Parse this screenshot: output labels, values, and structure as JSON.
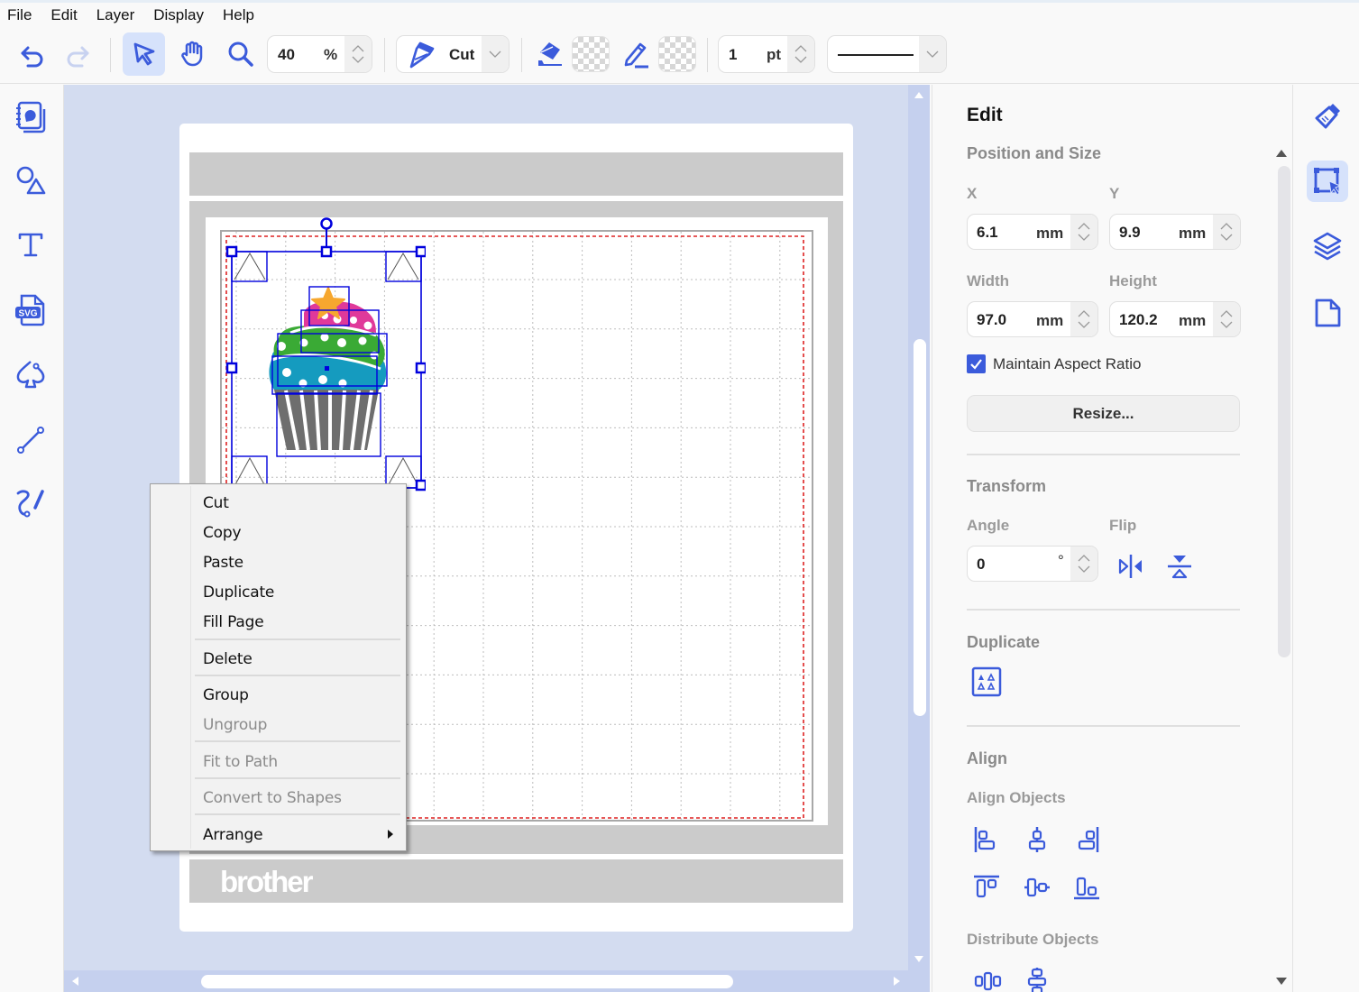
{
  "menubar": {
    "items": [
      "File",
      "Edit",
      "Layer",
      "Display",
      "Help"
    ]
  },
  "toolbar": {
    "undo_icon": "undo-arrow-icon",
    "redo_icon": "redo-arrow-icon",
    "select_tool_icon": "pointer-icon",
    "pan_tool_icon": "hand-icon",
    "zoom_tool_icon": "magnifier-icon",
    "zoom_value": "40",
    "zoom_unit": "%",
    "mode_label": "Cut",
    "mode_icon": "cutter-blade-icon",
    "fill_icon": "paint-bucket-icon",
    "fill_color": "transparent",
    "stroke_icon": "pencil-icon",
    "stroke_color": "transparent",
    "line_width_value": "1",
    "line_width_unit": "pt",
    "line_style": "solid"
  },
  "left_rail": {
    "items": [
      {
        "name": "pattern-library",
        "icon": "pattern-book-icon"
      },
      {
        "name": "shapes",
        "icon": "shapes-icon"
      },
      {
        "name": "text",
        "icon": "text-icon"
      },
      {
        "name": "import-svg",
        "icon": "svg-file-icon"
      },
      {
        "name": "path-edit",
        "icon": "spade-node-icon"
      },
      {
        "name": "line",
        "icon": "line-icon"
      },
      {
        "name": "freehand",
        "icon": "freehand-icon"
      }
    ]
  },
  "canvas": {
    "mat_brand": "brother",
    "accent_color": "#0000dd",
    "cut_boundary_color": "#dd2222",
    "selected_object": "cupcake"
  },
  "context_menu": {
    "items": [
      {
        "label": "Cut",
        "enabled": true
      },
      {
        "label": "Copy",
        "enabled": true
      },
      {
        "label": "Paste",
        "enabled": true
      },
      {
        "label": "Duplicate",
        "enabled": true
      },
      {
        "label": "Fill Page",
        "enabled": true
      },
      {
        "label": "Delete",
        "enabled": true
      },
      {
        "label": "Group",
        "enabled": true
      },
      {
        "label": "Ungroup",
        "enabled": false
      },
      {
        "label": "Fit to Path",
        "enabled": false
      },
      {
        "label": "Convert to Shapes",
        "enabled": false
      },
      {
        "label": "Arrange",
        "enabled": true,
        "submenu": true
      }
    ]
  },
  "edit_panel": {
    "title": "Edit",
    "position_size": {
      "heading": "Position and Size",
      "x_label": "X",
      "x_value": "6.1",
      "x_unit": "mm",
      "y_label": "Y",
      "y_value": "9.9",
      "y_unit": "mm",
      "width_label": "Width",
      "width_value": "97.0",
      "width_unit": "mm",
      "height_label": "Height",
      "height_value": "120.2",
      "height_unit": "mm",
      "aspect_label": "Maintain Aspect Ratio",
      "aspect_checked": true,
      "resize_label": "Resize..."
    },
    "transform": {
      "heading": "Transform",
      "angle_label": "Angle",
      "angle_value": "0",
      "angle_unit": "°",
      "flip_label": "Flip"
    },
    "duplicate": {
      "heading": "Duplicate"
    },
    "align": {
      "heading": "Align",
      "align_objects_label": "Align Objects",
      "distribute_label": "Distribute Objects"
    }
  },
  "right_rail": {
    "items": [
      {
        "name": "paint",
        "icon": "paintbrush-icon",
        "active": false
      },
      {
        "name": "edit",
        "icon": "transform-select-icon",
        "active": true
      },
      {
        "name": "layers",
        "icon": "layers-icon",
        "active": false
      },
      {
        "name": "page",
        "icon": "page-icon",
        "active": false
      }
    ]
  },
  "colors": {
    "accent": "#3b5bdb",
    "canvas_bg": "#d3dcf0",
    "selection": "#0000dd"
  }
}
